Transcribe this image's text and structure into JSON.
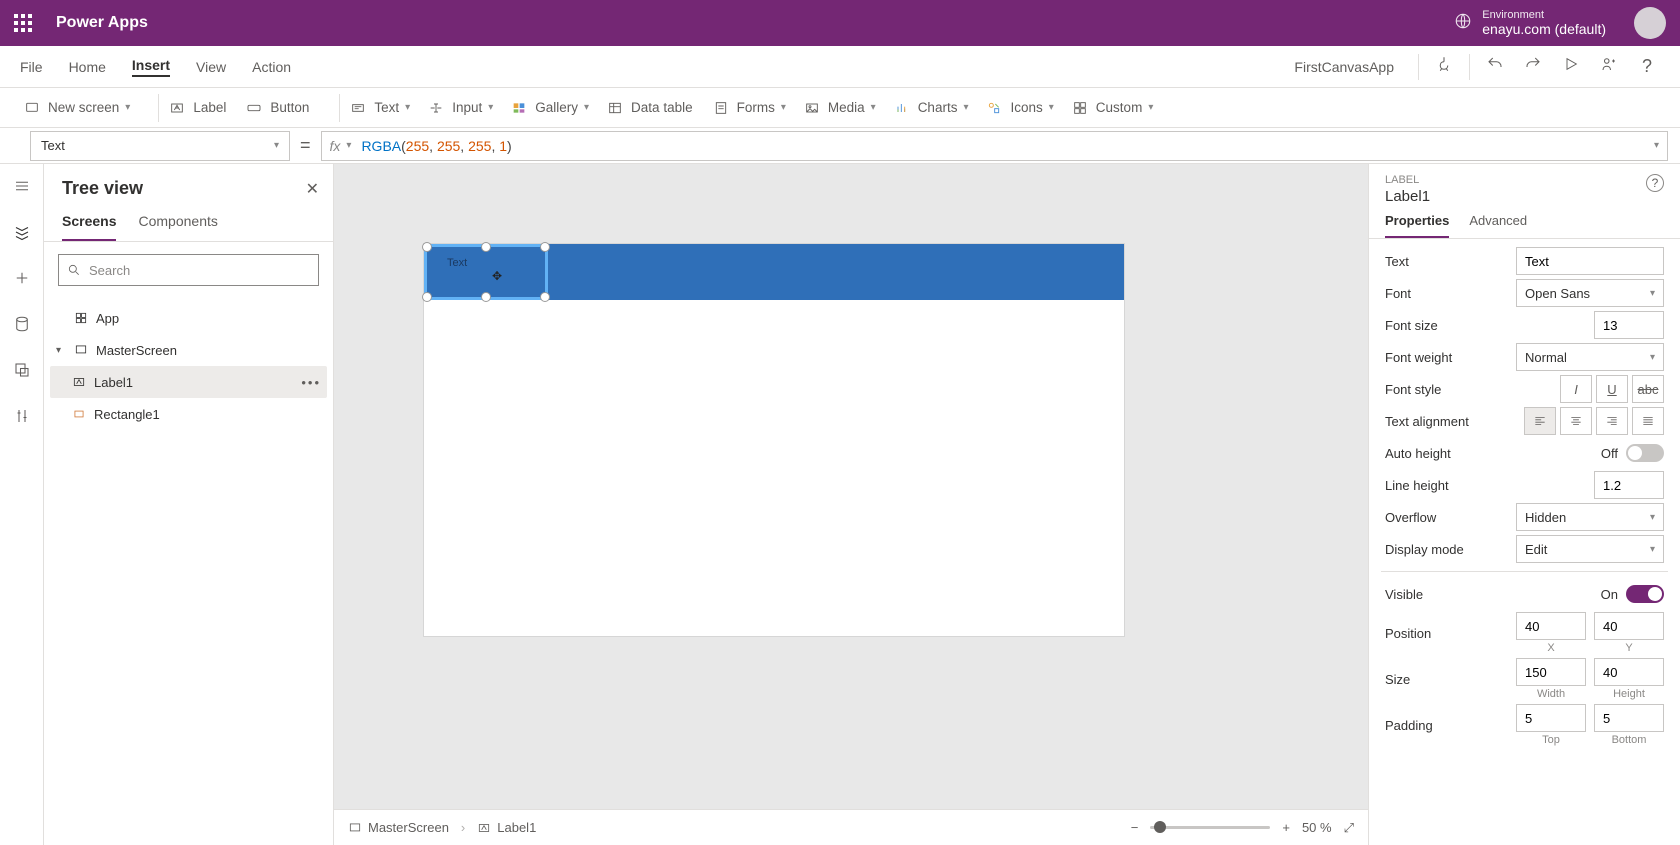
{
  "brand": "Power Apps",
  "environment": {
    "label": "Environment",
    "value": "enayu.com (default)"
  },
  "appName": "FirstCanvasApp",
  "menu": {
    "file": "File",
    "home": "Home",
    "insert": "Insert",
    "view": "View",
    "action": "Action"
  },
  "ribbon": {
    "newScreen": "New screen",
    "label": "Label",
    "button": "Button",
    "text": "Text",
    "input": "Input",
    "gallery": "Gallery",
    "dataTable": "Data table",
    "forms": "Forms",
    "media": "Media",
    "charts": "Charts",
    "icons": "Icons",
    "custom": "Custom"
  },
  "formula": {
    "propertyName": "Text",
    "fn": "RGBA",
    "args": [
      "255",
      "255",
      "255",
      "1"
    ]
  },
  "tree": {
    "title": "Tree view",
    "tabs": {
      "screens": "Screens",
      "components": "Components"
    },
    "searchPlaceholder": "Search",
    "app": "App",
    "screen": "MasterScreen",
    "items": {
      "label1": "Label1",
      "rect1": "Rectangle1"
    }
  },
  "canvas": {
    "selectedLabelText": "Text"
  },
  "breadcrumb": {
    "screen": "MasterScreen",
    "control": "Label1"
  },
  "zoom": {
    "value": "50",
    "unit": "%"
  },
  "props": {
    "type": "LABEL",
    "name": "Label1",
    "tabs": {
      "properties": "Properties",
      "advanced": "Advanced"
    },
    "text": {
      "label": "Text",
      "value": "Text"
    },
    "font": {
      "label": "Font",
      "value": "Open Sans"
    },
    "fontSize": {
      "label": "Font size",
      "value": "13"
    },
    "fontWeight": {
      "label": "Font weight",
      "value": "Normal"
    },
    "fontStyle": {
      "label": "Font style"
    },
    "textAlign": {
      "label": "Text alignment"
    },
    "autoHeight": {
      "label": "Auto height",
      "state": "Off"
    },
    "lineHeight": {
      "label": "Line height",
      "value": "1.2"
    },
    "overflow": {
      "label": "Overflow",
      "value": "Hidden"
    },
    "displayMode": {
      "label": "Display mode",
      "value": "Edit"
    },
    "visible": {
      "label": "Visible",
      "state": "On"
    },
    "position": {
      "label": "Position",
      "x": "40",
      "y": "40",
      "xLabel": "X",
      "yLabel": "Y"
    },
    "size": {
      "label": "Size",
      "w": "150",
      "h": "40",
      "wLabel": "Width",
      "hLabel": "Height"
    },
    "padding": {
      "label": "Padding",
      "top": "5",
      "bottom": "5",
      "topLabel": "Top",
      "bottomLabel": "Bottom"
    }
  }
}
